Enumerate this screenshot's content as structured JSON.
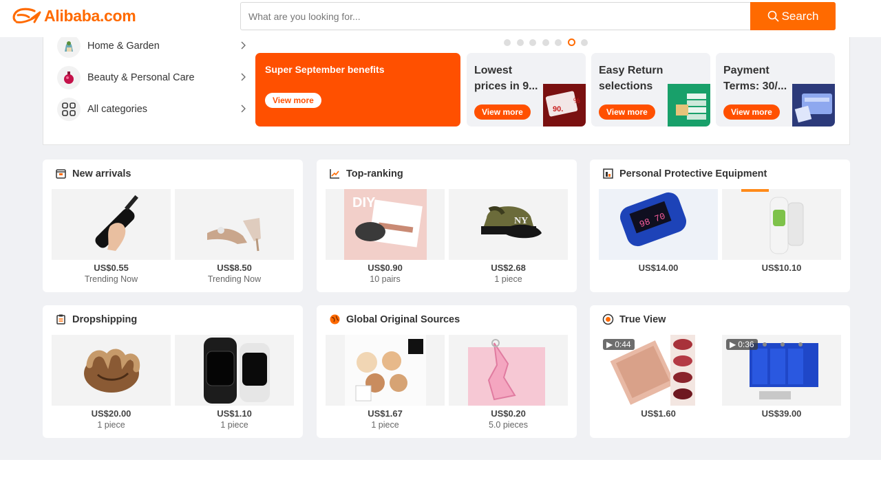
{
  "header": {
    "logo_text": "Alibaba.com",
    "search_placeholder": "What are you looking for...",
    "search_button": "Search",
    "brand_color": "#ff6a00"
  },
  "categories": [
    {
      "label": "Home & Garden",
      "icon": "home-garden-icon"
    },
    {
      "label": "Beauty & Personal Care",
      "icon": "beauty-icon"
    },
    {
      "label": "All categories",
      "icon": "grid-icon"
    }
  ],
  "carousel": {
    "dot_count": 7,
    "active_index": 5
  },
  "promos": {
    "main": {
      "title": "Super September benefits",
      "button": "View more"
    },
    "cards": [
      {
        "title": "Lowest\nprices in 9...",
        "button": "View more",
        "image": "price-tag-image"
      },
      {
        "title": "Easy Return\nselections",
        "button": "View more",
        "image": "return-box-image"
      },
      {
        "title": "Payment\nTerms: 30/...",
        "button": "View more",
        "image": "payment-card-image"
      }
    ]
  },
  "sections": [
    {
      "title": "New arrivals",
      "icon": "new-arrivals-icon",
      "products": [
        {
          "price": "US$0.55",
          "sub": "Trending Now",
          "image": "umbrella"
        },
        {
          "price": "US$8.50",
          "sub": "Trending Now",
          "image": "heels"
        }
      ]
    },
    {
      "title": "Top-ranking",
      "icon": "trend-icon",
      "products": [
        {
          "price": "US$0.90",
          "sub": "10 pairs",
          "image": "lashes"
        },
        {
          "price": "US$2.68",
          "sub": "1 piece",
          "image": "cap"
        }
      ]
    },
    {
      "title": "Personal Protective Equipment",
      "icon": "ppe-icon",
      "products": [
        {
          "price": "US$14.00",
          "sub": "",
          "image": "oximeter"
        },
        {
          "price": "US$10.10",
          "sub": "",
          "image": "thermometer"
        }
      ]
    },
    {
      "title": "Dropshipping",
      "icon": "clipboard-icon",
      "products": [
        {
          "price": "US$20.00",
          "sub": "1 piece",
          "image": "glove"
        },
        {
          "price": "US$1.10",
          "sub": "1 piece",
          "image": "smartwatch"
        }
      ]
    },
    {
      "title": "Global Original Sources",
      "icon": "globe-icon",
      "products": [
        {
          "price": "US$1.67",
          "sub": "1 piece",
          "image": "eyeshadow"
        },
        {
          "price": "US$0.20",
          "sub": "5.0 pieces",
          "image": "keychain"
        }
      ]
    },
    {
      "title": "True View",
      "icon": "play-circle-icon",
      "products": [
        {
          "price": "US$1.60",
          "sub": "",
          "image": "lipstick",
          "video": "0:44"
        },
        {
          "price": "US$39.00",
          "sub": "",
          "image": "battery",
          "video": "0:36"
        }
      ]
    }
  ]
}
